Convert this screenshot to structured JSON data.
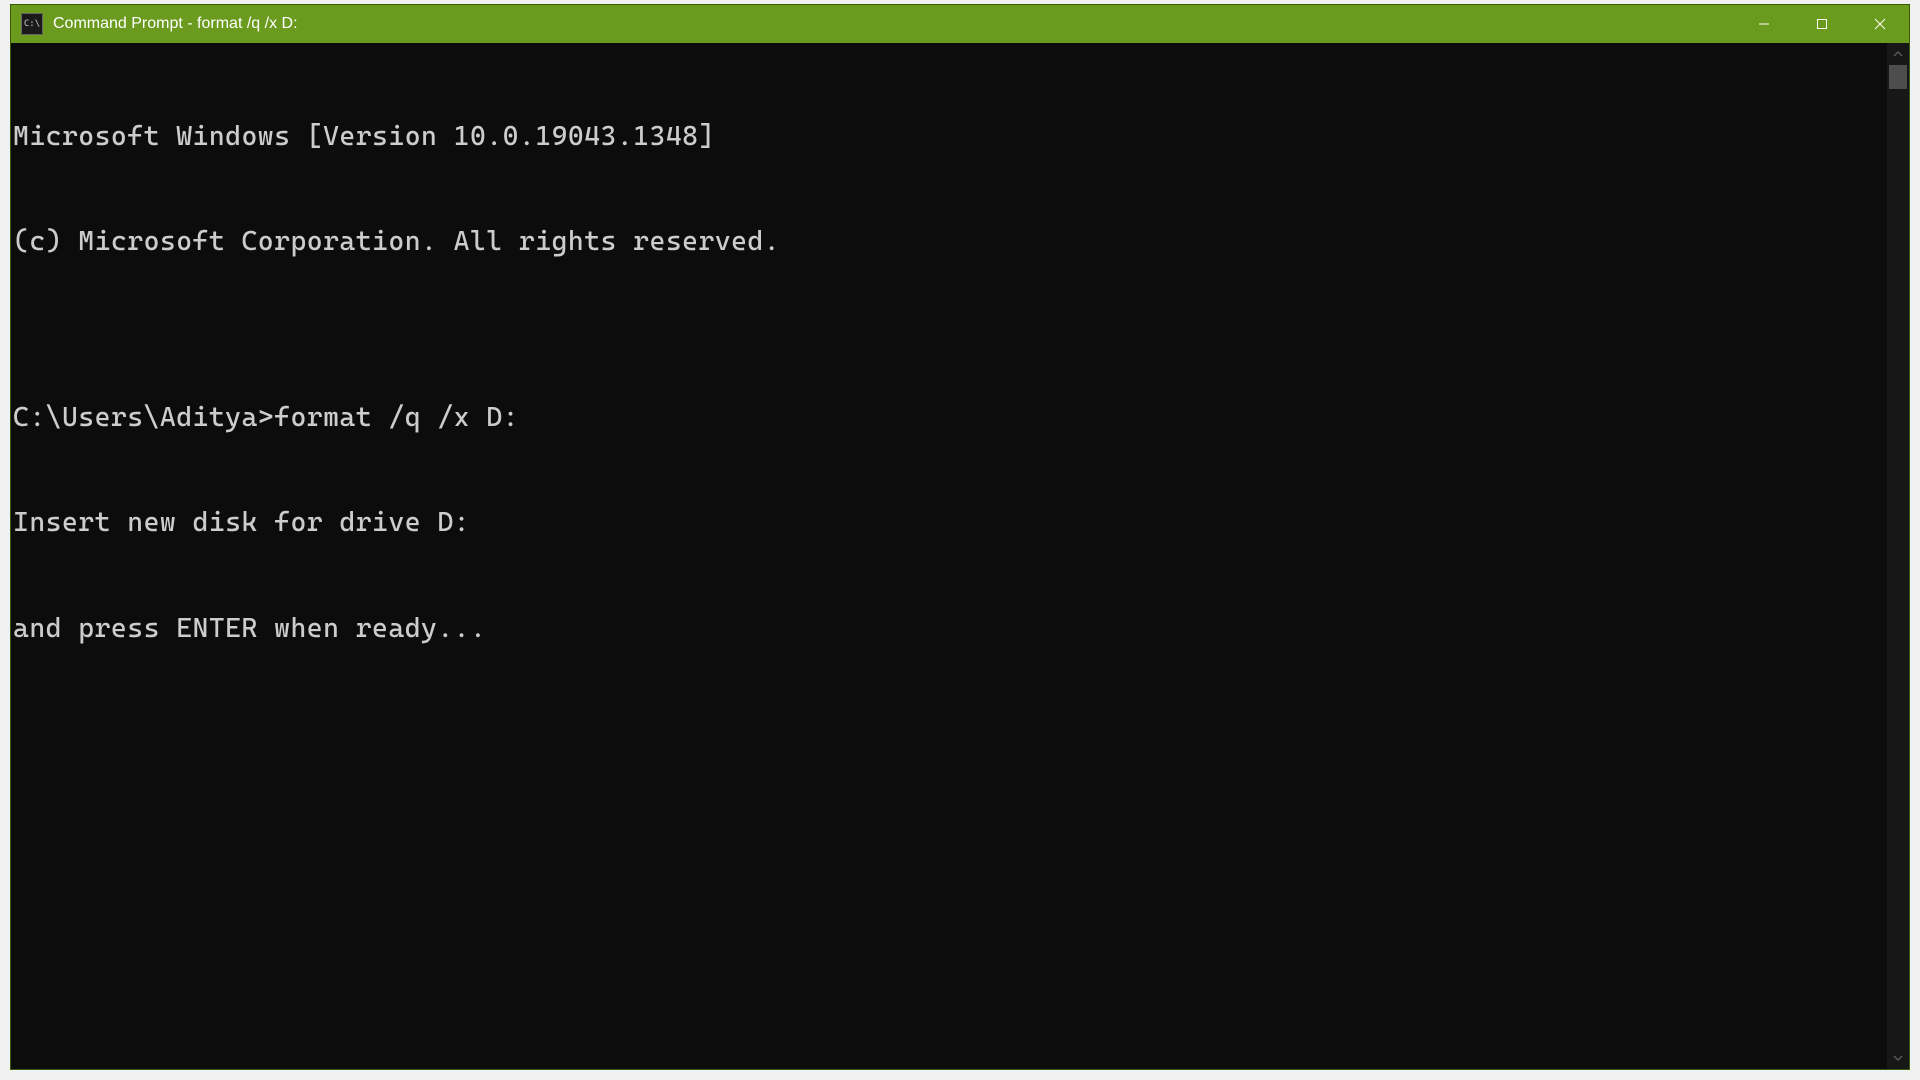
{
  "titlebar": {
    "icon_label": "C:\\",
    "title": "Command Prompt - format  /q /x D:"
  },
  "terminal": {
    "lines": [
      "Microsoft Windows [Version 10.0.19043.1348]",
      "(c) Microsoft Corporation. All rights reserved.",
      "",
      "C:\\Users\\Aditya>format /q /x D:",
      "Insert new disk for drive D:",
      "and press ENTER when ready..."
    ]
  },
  "controls": {
    "minimize_label": "Minimize",
    "maximize_label": "Maximize",
    "close_label": "Close"
  }
}
